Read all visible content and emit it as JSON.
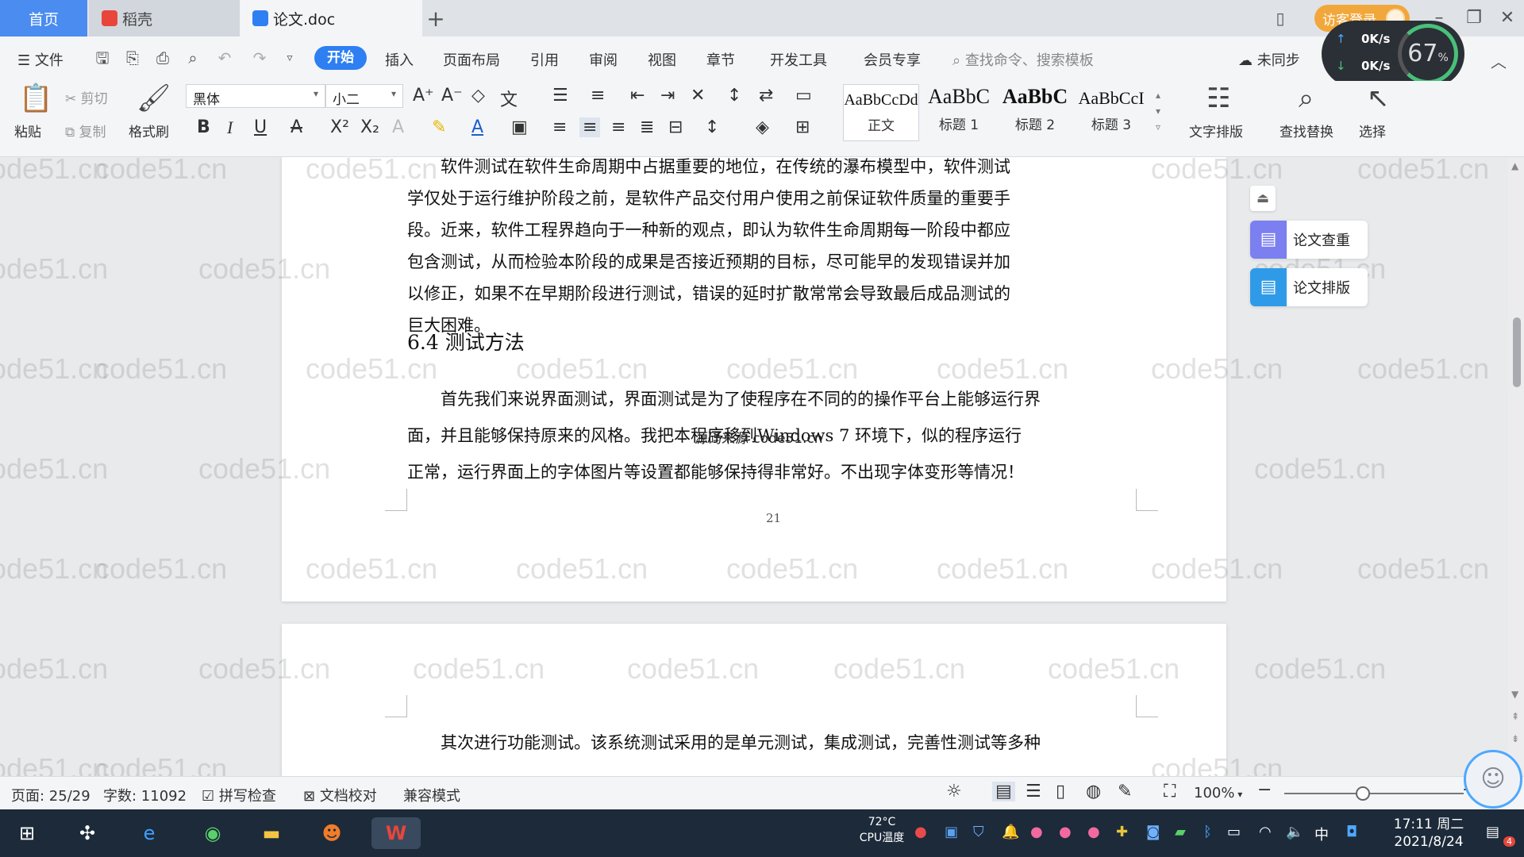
{
  "tabs": {
    "home": "首页",
    "docer": "稻壳",
    "doc": "论文.doc",
    "add": "+"
  },
  "header": {
    "login": "访客登录"
  },
  "menu": {
    "file": "文件",
    "start": "开始",
    "insert": "插入",
    "layout": "页面布局",
    "refs": "引用",
    "review": "审阅",
    "view": "视图",
    "chapter": "章节",
    "devtools": "开发工具",
    "member": "会员专享",
    "search_placeholder": "查找命令、搜索模板",
    "sync": "未同步"
  },
  "speed_widget": {
    "up": "0K/s",
    "down": "0K/s",
    "percent": "67",
    "unit": "%"
  },
  "ribbon": {
    "paste": "粘贴",
    "cut": "剪切",
    "copy": "复制",
    "format_painter": "格式刷",
    "font_name": "黑体",
    "font_size": "小二",
    "styles": [
      {
        "preview": "AaBbCcDd",
        "label": "正文"
      },
      {
        "preview": "AaBbC",
        "label": "标题 1"
      },
      {
        "preview": "AaBbC",
        "label": "标题 2"
      },
      {
        "preview": "AaBbCcI",
        "label": "标题 3"
      }
    ],
    "text_layout": "文字排版",
    "find_replace": "查找替换",
    "select": "选择"
  },
  "document": {
    "para1": "软件测试在软件生命周期中占据重要的地位，在传统的瀑布模型中，软件测试学仅处于运行维护阶段之前，是软件产品交付用户使用之前保证软件质量的重要手段。近来，软件工程界趋向于一种新的观点，即认为软件生命周期每一阶段中都应包含测试，从而检验本阶段的成果是否接近预期的目标，尽可能早的发现错误并加以修正，如果不在早期阶段进行测试，错误的延时扩散常常会导致最后成品测试的巨大困难。",
    "heading": "6.4 测试方法",
    "para2_line1": "首先我们来说界面测试，界面测试是为了使程序在不同的的操作平台上能够运行界",
    "para2_line2": "面，并且能够保持原来的风格。我把本程序移到Windows 7 环境下，似的程序运行",
    "para2_line3": "正常，运行界面上的字体图片等设置都能够保持得非常好。不出现字体变形等情况！",
    "overlay_text": "源码来源 code51.cn",
    "page_number": "21",
    "para3": "其次进行功能测试。该系统测试采用的是单元测试，集成测试，完善性测试等多种",
    "watermark": "code51.cn"
  },
  "side_panel": {
    "check": "论文查重",
    "typeset": "论文排版"
  },
  "status": {
    "page": "页面: 25/29",
    "words": "字数: 11092",
    "spell": "拼写检查",
    "proof": "文档校对",
    "compat": "兼容模式",
    "zoom": "100%"
  },
  "taskbar": {
    "temp": "72°C",
    "cpu": "CPU温度",
    "time": "17:11 周二",
    "date": "2021/8/24",
    "ime": "中",
    "notif": "4"
  }
}
